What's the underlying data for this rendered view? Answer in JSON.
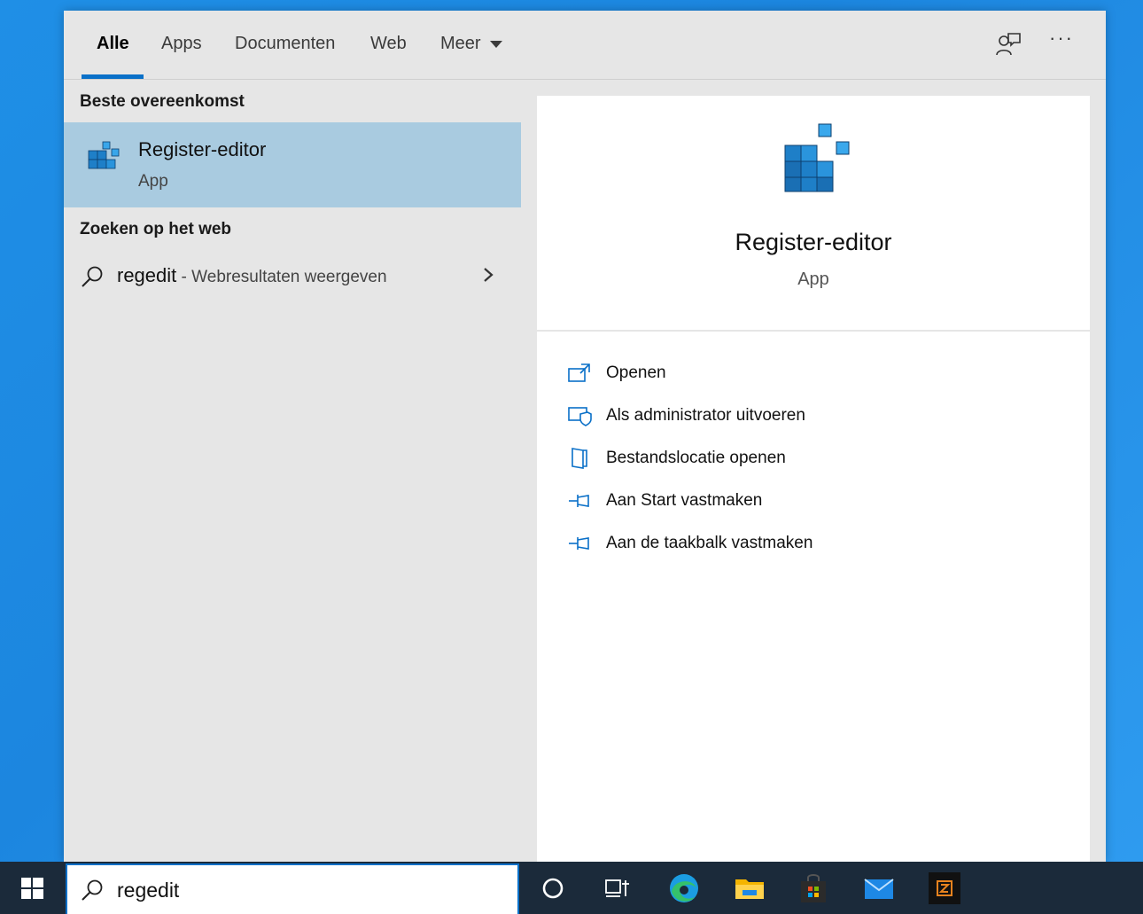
{
  "tabs": [
    {
      "label": "Alle",
      "active": true
    },
    {
      "label": "Apps"
    },
    {
      "label": "Documenten"
    },
    {
      "label": "Web"
    },
    {
      "label": "Meer"
    }
  ],
  "top_icons": [
    "feedback-icon",
    "more-options-icon"
  ],
  "more_options": "···",
  "best_match": {
    "section_title": "Beste overeenkomst",
    "name": "Register-editor",
    "type": "App"
  },
  "web_search": {
    "section_title": "Zoeken op het web",
    "query": "regedit",
    "hint": " - Webresultaten weergeven"
  },
  "detail": {
    "title": "Register-editor",
    "subtitle": "App"
  },
  "actions": [
    {
      "label": "Openen",
      "icon": "open-icon"
    },
    {
      "label": "Als administrator uitvoeren",
      "icon": "run-as-admin-icon"
    },
    {
      "label": "Bestandslocatie openen",
      "icon": "file-location-icon"
    },
    {
      "label": "Aan Start vastmaken",
      "icon": "pin-icon"
    },
    {
      "label": "Aan de taakbalk vastmaken",
      "icon": "pin-icon"
    }
  ],
  "taskbar": {
    "search_value": "regedit",
    "icons": [
      "windows-start-icon",
      "cortana-icon",
      "task-view-icon",
      "edge-icon",
      "file-explorer-icon",
      "store-icon",
      "mail-icon",
      "app-z-icon"
    ]
  },
  "colors": {
    "accent": "#0a70c8",
    "selection": "#a9cbe0",
    "taskbar": "#1b2a3a",
    "desktop": "#1f8fe6"
  }
}
